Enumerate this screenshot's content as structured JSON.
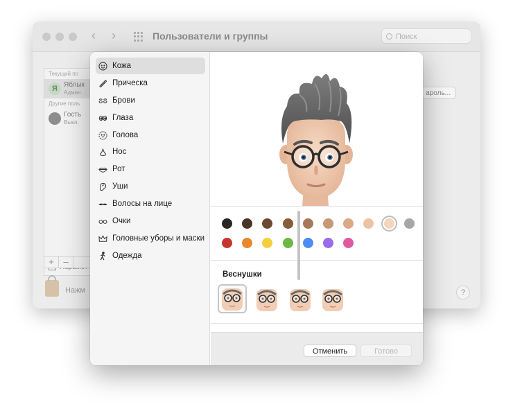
{
  "background_window": {
    "title": "Пользователи и группы",
    "search_placeholder": "Поиск",
    "current_users_header": "Текущий по",
    "current_user": {
      "initial": "Я",
      "name": "Яблык",
      "role": "Админ"
    },
    "other_users_header": "Другие поль",
    "guest_user": {
      "name": "Гость",
      "status": "Выкл."
    },
    "login_options": "Парамет",
    "plus": "+",
    "minus": "–",
    "password_button": "ароль...",
    "lock_note": "Нажм",
    "help": "?"
  },
  "sidebar": {
    "items": [
      {
        "label": "Кожа",
        "icon": "face-icon",
        "active": true
      },
      {
        "label": "Прическа",
        "icon": "comb-icon",
        "active": false
      },
      {
        "label": "Брови",
        "icon": "eyebrow-icon",
        "active": false
      },
      {
        "label": "Глаза",
        "icon": "eyes-icon",
        "active": false
      },
      {
        "label": "Голова",
        "icon": "head-icon",
        "active": false
      },
      {
        "label": "Нос",
        "icon": "nose-icon",
        "active": false
      },
      {
        "label": "Рот",
        "icon": "mouth-icon",
        "active": false
      },
      {
        "label": "Уши",
        "icon": "ear-icon",
        "active": false
      },
      {
        "label": "Волосы на лице",
        "icon": "mustache-icon",
        "active": false
      },
      {
        "label": "Очки",
        "icon": "glasses-icon",
        "active": false
      },
      {
        "label": "Головные уборы и маски",
        "icon": "crown-icon",
        "active": false
      },
      {
        "label": "Одежда",
        "icon": "person-icon",
        "active": false
      }
    ]
  },
  "palette": {
    "row1": [
      "#2b2624",
      "#4a3427",
      "#6b4a31",
      "#855c3c",
      "#a7785a",
      "#c79878",
      "#dba888",
      "#ecc3a4",
      "#f4d5bd",
      "#a6a6a6"
    ],
    "row2": [
      "#c9352c",
      "#e8892c",
      "#f4ce3c",
      "#6bb944",
      "#4c8ef0",
      "#9a6bea",
      "#dd5aa2"
    ],
    "selected_index": 8
  },
  "freckles": {
    "title": "Веснушки",
    "options": 4,
    "selected_index": 0
  },
  "footer": {
    "cancel_label": "Отменить",
    "done_label": "Готово"
  }
}
